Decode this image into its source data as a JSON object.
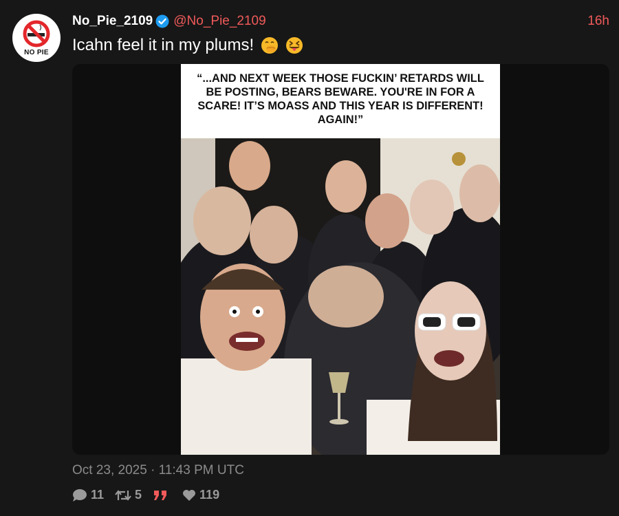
{
  "tweet": {
    "avatar_text": "NO PIE",
    "display_name": "No_Pie_2109",
    "handle": "@No_Pie_2109",
    "time_ago": "16h",
    "text": "Icahn feel it in my plums!",
    "emojis": [
      "face-with-hand-over-mouth-emoji",
      "squinting-face-with-tongue-emoji"
    ],
    "media": {
      "caption": "“...AND NEXT WEEK THOSE FUCKIN’ RETARDS WILL BE POSTING, BEARS BEWARE. YOU'RE IN FOR A SCARE! IT’S MOASS AND THIS YEAR IS DIFFERENT! AGAIN!”"
    },
    "timestamp": "Oct 23, 2025 · 11:43 PM UTC",
    "stats": {
      "replies": "11",
      "retweets": "5",
      "quotes": "",
      "likes": "119"
    }
  },
  "colors": {
    "background": "#171717",
    "accent": "#f15a5a",
    "verified": "#1d9bf0",
    "muted": "#8b8b8b"
  }
}
